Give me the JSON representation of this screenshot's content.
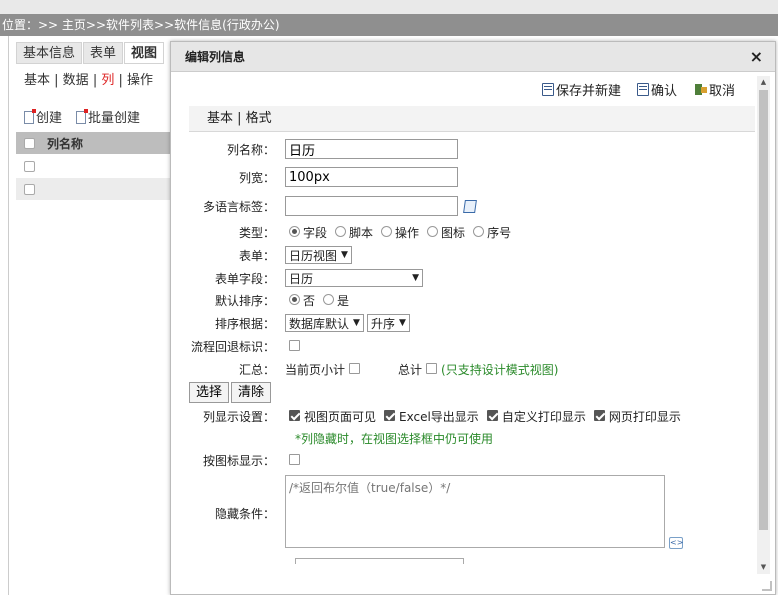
{
  "breadcrumb": "位置：>> 主页>>软件列表>>软件信息(行政办公)",
  "bg": {
    "tabs": [
      "基本信息",
      "表单",
      "视图"
    ],
    "subnav": [
      "基本",
      "数据",
      "列",
      "操作"
    ],
    "tools": [
      "创建",
      "批量创建"
    ],
    "grid_header": "列名称"
  },
  "dialog": {
    "title": "编辑列信息",
    "close": "×",
    "toolbar": {
      "save_new": "保存并新建",
      "confirm": "确认",
      "cancel": "取消"
    },
    "subtabs": "基本 | 格式",
    "fields": {
      "name_label": "列名称：",
      "name_value": "日历",
      "width_label": "列宽：",
      "width_value": "100px",
      "lang_label": "多语言标签：",
      "lang_value": "",
      "type_label": "类型：",
      "type_options": [
        "字段",
        "脚本",
        "操作",
        "图标",
        "序号"
      ],
      "form_label": "表单：",
      "form_value": "日历视图",
      "formfield_label": "表单字段：",
      "formfield_value": "日历",
      "defsort_label": "默认排序：",
      "defsort_options": [
        "否",
        "是"
      ],
      "sortby_label": "排序根据：",
      "sortby_value": "数据库默认",
      "sortorder_value": "升序",
      "flowback_label": "流程回退标识：",
      "summary_label": "汇总：",
      "summary_page": "当前页小计",
      "summary_total": "总计",
      "summary_note": "(只支持设计模式视图)",
      "select_btn": "选择",
      "clear_btn": "清除",
      "display_label": "列显示设置：",
      "display_options": [
        "视图页面可见",
        "Excel导出显示",
        "自定义打印显示",
        "网页打印显示"
      ],
      "display_note": "*列隐藏时，在视图选择框中仍可使用",
      "iconshow_label": "按图标显示：",
      "hide_label": "隐藏条件：",
      "hide_placeholder": "/*返回布尔值（true/false）*/"
    }
  }
}
